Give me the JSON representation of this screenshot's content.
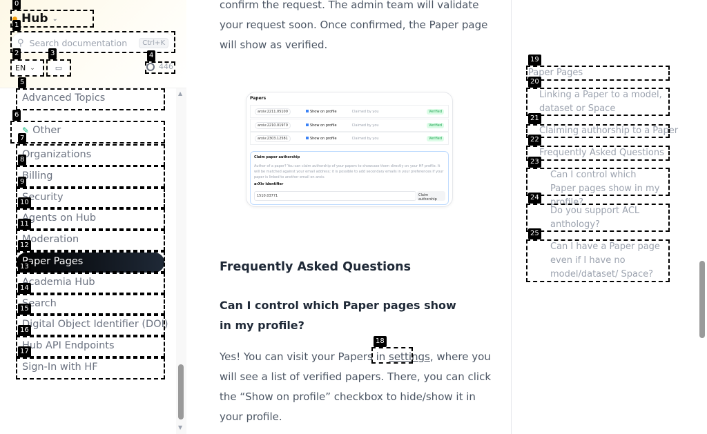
{
  "sidebar": {
    "title": "Hub",
    "search_placeholder": "Search documentation",
    "search_shortcut": "Ctrl+K",
    "language": "EN",
    "github_stars": "446",
    "items": [
      {
        "label": "Advanced Topics"
      },
      {
        "label": "Other",
        "icon": "leaf-icon"
      },
      {
        "label": "Organizations"
      },
      {
        "label": "Billing"
      },
      {
        "label": "Security"
      },
      {
        "label": "Agents on Hub"
      },
      {
        "label": "Moderation"
      },
      {
        "label": "Paper Pages",
        "active": true
      },
      {
        "label": "Academia Hub"
      },
      {
        "label": "Search"
      },
      {
        "label": "Digital Object Identifier (DOI)"
      },
      {
        "label": "Hub API Endpoints"
      },
      {
        "label": "Sign-In with HF"
      }
    ]
  },
  "main": {
    "intro_lines": [
      "confirm the request. The admin team will validate",
      "your request soon. Once confirmed, the Paper page",
      "will show as verified."
    ],
    "screenshot": {
      "title": "Papers",
      "rows": [
        {
          "id": "arxiv:2211.05100",
          "checkbox": "Show on profile",
          "claimed": "Claimed by you",
          "status": "Verified"
        },
        {
          "id": "arxiv:2210.01970",
          "checkbox": "Show on profile",
          "claimed": "Claimed by you",
          "status": "Verified"
        },
        {
          "id": "arxiv:2303.12581",
          "checkbox": "Show on profile",
          "claimed": "Claimed by you",
          "status": "Verified"
        }
      ],
      "claim_title": "Claim paper authorship",
      "claim_desc": "Author of a paper? You can claim authorship of your papers to showcase them directly on your HF profile. It will be matched against your email address; it is possible to add secondary emails in your preferences if your paper is linked to another email on arxiv.",
      "claim_label": "arXiv identifier",
      "claim_value": "1510.03771",
      "claim_button": "Claim authorship"
    },
    "faq_heading": "Frequently Asked Questions",
    "q1": "Can I control which Paper pages show in my profile?",
    "a1_before": "Yes! You can visit your Papers in ",
    "a1_link": "settings",
    "a1_after": ", where you",
    "a1_lines": [
      "will see a list of verified papers. There, you can click",
      "the “Show on profile” checkbox to hide/show it in",
      "your profile."
    ]
  },
  "toc": {
    "items": [
      {
        "label": "Paper Pages",
        "level": 1
      },
      {
        "label": "Linking a Paper to a model, dataset or Space",
        "level": 2
      },
      {
        "label": "Claiming authorship to a Paper",
        "level": 2
      },
      {
        "label": "Frequently Asked Questions",
        "level": 2
      },
      {
        "label": "Can I control which Paper pages show in my profile?",
        "level": 3
      },
      {
        "label": "Do you support ACL anthology?",
        "level": 3
      },
      {
        "label": "Can I have a Paper page even if I have no model/dataset/ Space?",
        "level": 3
      }
    ]
  },
  "marks": [
    "0",
    "1",
    "2",
    "3",
    "4",
    "5",
    "6",
    "7",
    "8",
    "9",
    "10",
    "11",
    "12",
    "13",
    "14",
    "15",
    "16",
    "17",
    "18",
    "19",
    "20",
    "21",
    "22",
    "23",
    "24",
    "25"
  ],
  "colors": {
    "active_nav_bg": "#000000",
    "verified": "#16a34a",
    "accent_leaf": "#10b981"
  }
}
